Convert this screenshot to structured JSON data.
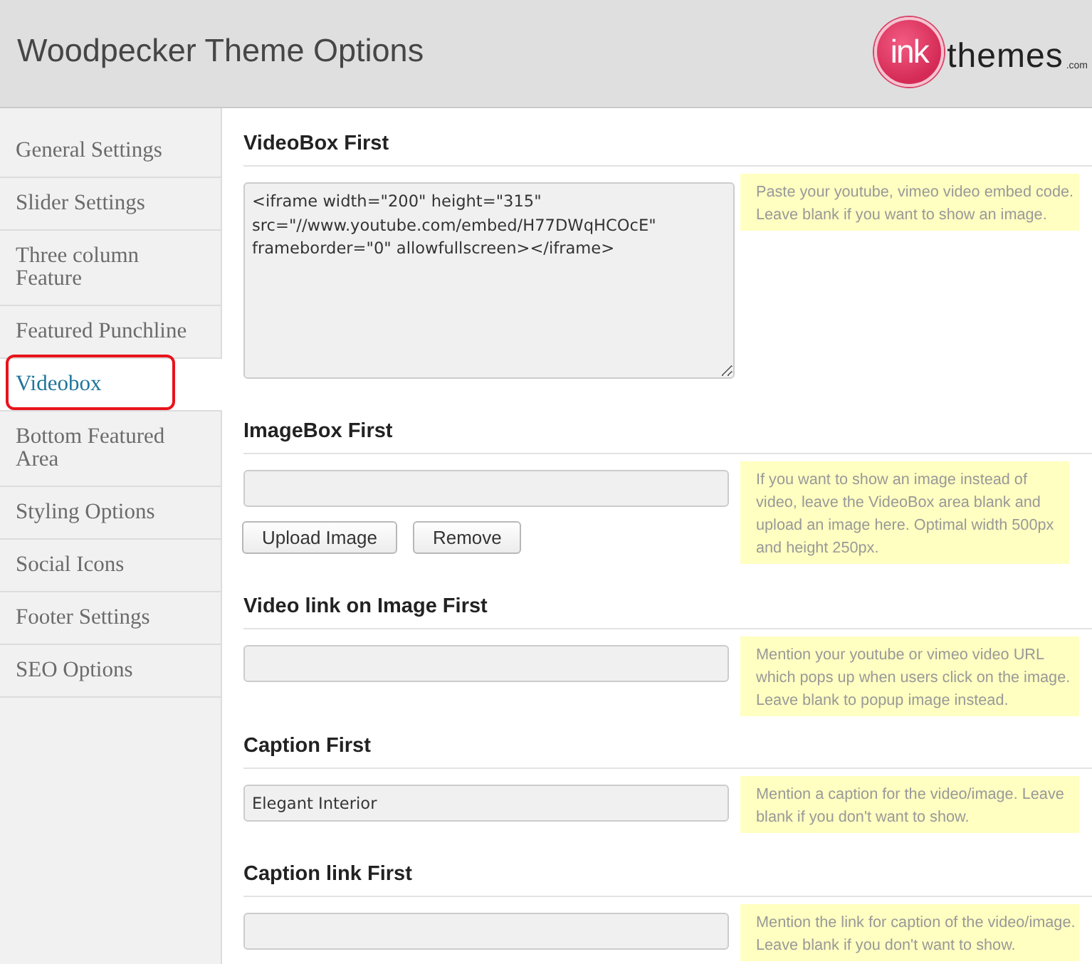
{
  "header": {
    "title": "Woodpecker Theme Options",
    "logo": {
      "mark": "ink",
      "name": "themes",
      "suffix": ".com"
    }
  },
  "sidebar": {
    "items": [
      {
        "label": "General Settings",
        "selected": false
      },
      {
        "label": "Slider Settings",
        "selected": false
      },
      {
        "label": "Three column Feature",
        "selected": false
      },
      {
        "label": "Featured Punchline",
        "selected": false
      },
      {
        "label": "Videobox",
        "selected": true
      },
      {
        "label": "Bottom Featured Area",
        "selected": false
      },
      {
        "label": "Styling Options",
        "selected": false
      },
      {
        "label": "Social Icons",
        "selected": false
      },
      {
        "label": "Footer Settings",
        "selected": false
      },
      {
        "label": "SEO Options",
        "selected": false
      }
    ]
  },
  "sections": [
    {
      "title": "VideoBox First",
      "field": {
        "kind": "textarea",
        "value": "<iframe width=\"200\" height=\"315\" src=\"//www.youtube.com/embed/H77DWqHCOcE\" frameborder=\"0\" allowfullscreen></iframe>"
      },
      "hint": "Paste your youtube, vimeo video embed code. Leave blank if you want to show an image."
    },
    {
      "title": "ImageBox First",
      "field": {
        "kind": "text"
      },
      "buttons": [
        "Upload Image",
        "Remove"
      ],
      "hint": "If you want to show an image instead of video, leave the VideoBox area blank and upload an image here. Optimal width 500px and height 250px."
    },
    {
      "title": "Video link on Image First",
      "field": {
        "kind": "text"
      },
      "hint": "Mention your youtube or vimeo video URL which pops up when users click on the image. Leave blank to popup image instead."
    },
    {
      "title": "Caption First",
      "field": {
        "kind": "text",
        "value": "Elegant Interior"
      },
      "hint": "Mention a caption for the video/image. Leave blank if you don't want to show."
    },
    {
      "title": "Caption link First",
      "field": {
        "kind": "text"
      },
      "hint": "Mention the link for caption of the video/image. Leave blank if you don't want to show."
    }
  ]
}
